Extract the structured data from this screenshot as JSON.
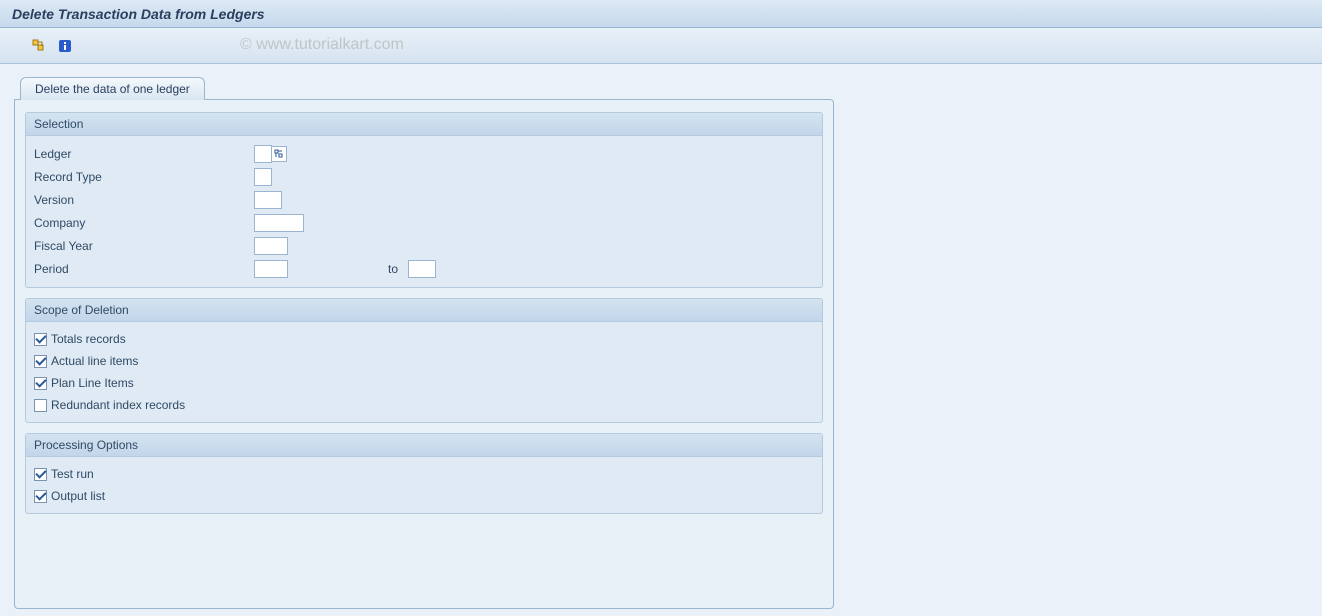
{
  "title": "Delete Transaction Data from Ledgers",
  "watermark": "© www.tutorialkart.com",
  "toolbar": {
    "icon1_name": "execute-icon",
    "icon2_name": "info-icon"
  },
  "tab": {
    "label": "Delete the data of one ledger"
  },
  "groups": {
    "selection": {
      "title": "Selection",
      "fields": {
        "ledger": {
          "label": "Ledger",
          "value": ""
        },
        "record_type": {
          "label": "Record Type",
          "value": ""
        },
        "version": {
          "label": "Version",
          "value": ""
        },
        "company": {
          "label": "Company",
          "value": ""
        },
        "fiscal_year": {
          "label": "Fiscal Year",
          "value": ""
        },
        "period": {
          "label": "Period",
          "from": "",
          "to_label": "to",
          "to": ""
        }
      }
    },
    "scope": {
      "title": "Scope of Deletion",
      "checks": [
        {
          "label": "Totals records",
          "checked": true
        },
        {
          "label": "Actual line items",
          "checked": true
        },
        {
          "label": "Plan Line Items",
          "checked": true
        },
        {
          "label": "Redundant index records",
          "checked": false
        }
      ]
    },
    "processing": {
      "title": "Processing Options",
      "checks": [
        {
          "label": "Test run",
          "checked": true
        },
        {
          "label": "Output list",
          "checked": true
        }
      ]
    }
  }
}
